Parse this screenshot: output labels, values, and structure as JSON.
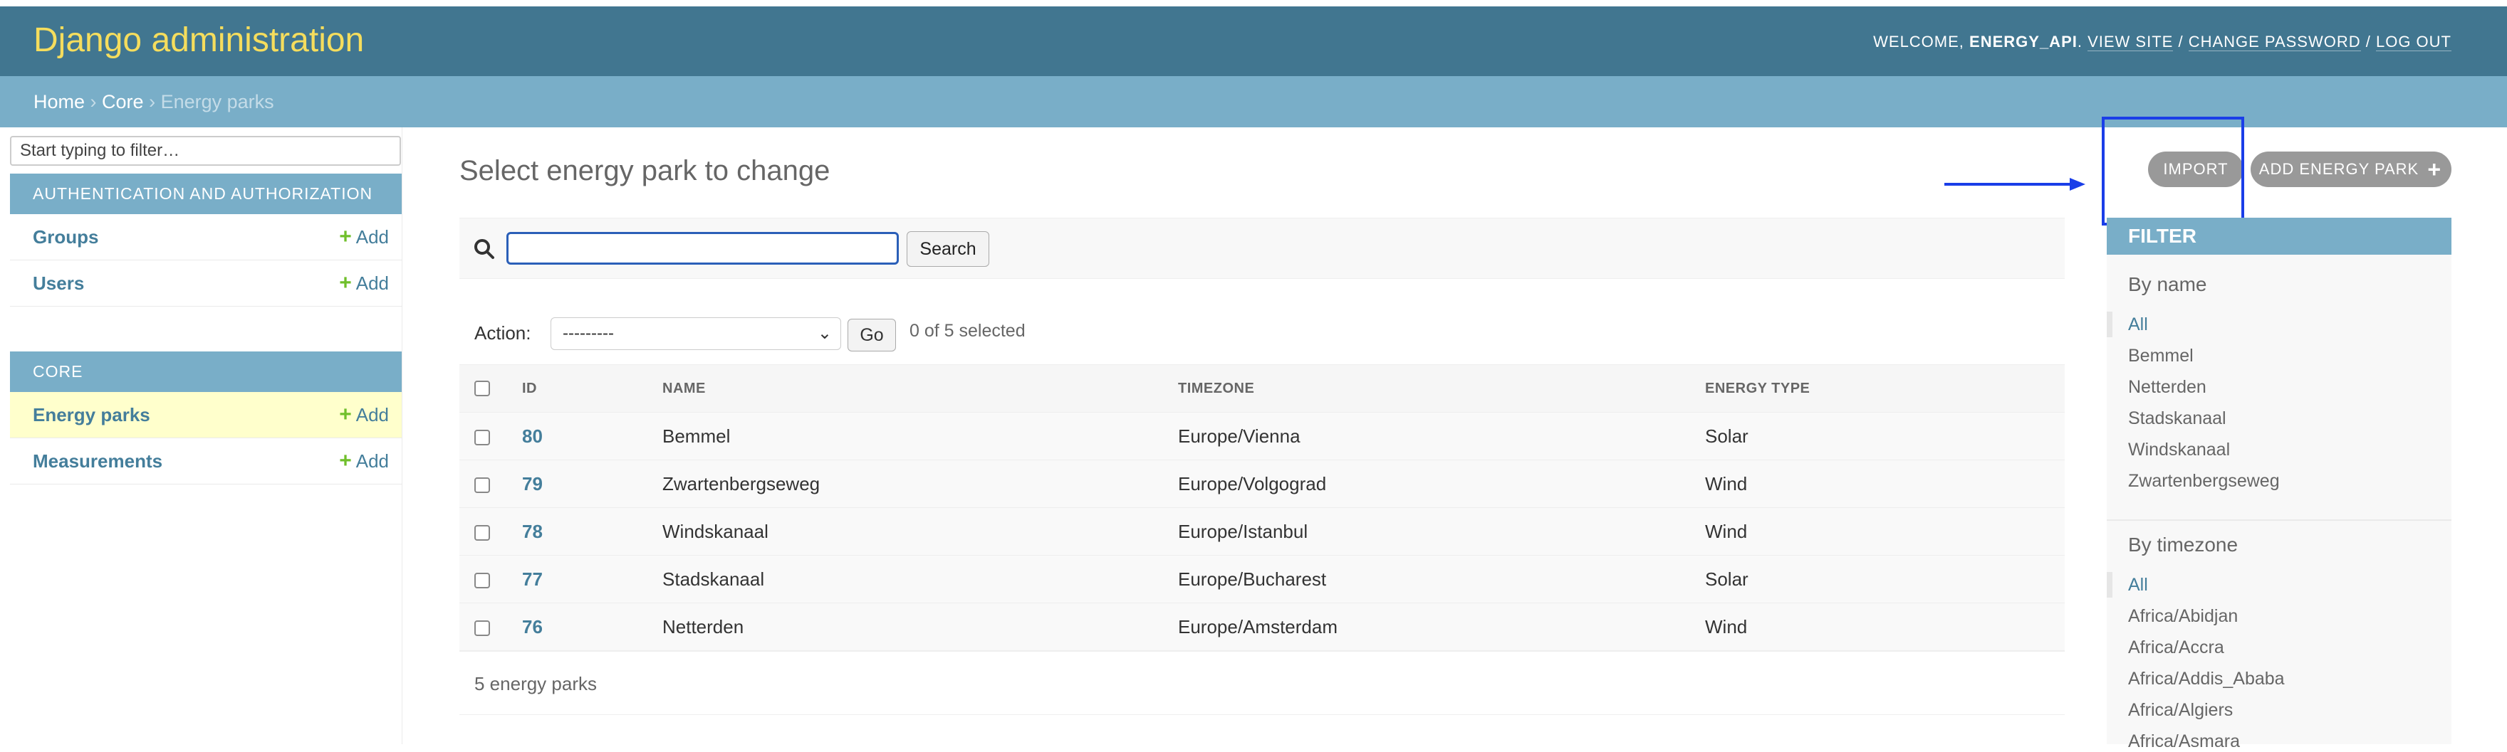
{
  "header": {
    "branding": "Django administration",
    "welcome": "WELCOME, ",
    "user": "ENERGY_API",
    "sep_after_user": ". ",
    "view_site": "VIEW SITE",
    "slash1": " / ",
    "change_password": "CHANGE PASSWORD",
    "slash2": " / ",
    "log_out": "LOG OUT"
  },
  "breadcrumbs": {
    "home": "Home",
    "sep1": " › ",
    "core": "Core",
    "sep2": " › ",
    "current": "Energy parks"
  },
  "sidebar": {
    "filter_placeholder": "Start typing to filter…",
    "auth_caption": "AUTHENTICATION AND AUTHORIZATION",
    "core_caption": "CORE",
    "add_label": "Add",
    "auth_models": [
      "Groups",
      "Users"
    ],
    "core_models": [
      "Energy parks",
      "Measurements"
    ]
  },
  "content": {
    "title": "Select energy park to change",
    "import_label": "IMPORT",
    "add_label": "ADD ENERGY PARK",
    "search_button": "Search",
    "search_value": "",
    "action_label": "Action:",
    "action_selected": "---------",
    "go_label": "Go",
    "selection_counter": "0 of 5 selected",
    "columns": [
      "ID",
      "NAME",
      "TIMEZONE",
      "ENERGY TYPE"
    ],
    "rows": [
      {
        "id": "80",
        "name": "Bemmel",
        "timezone": "Europe/Vienna",
        "energy_type": "Solar"
      },
      {
        "id": "79",
        "name": "Zwartenbergseweg",
        "timezone": "Europe/Volgograd",
        "energy_type": "Wind"
      },
      {
        "id": "78",
        "name": "Windskanaal",
        "timezone": "Europe/Istanbul",
        "energy_type": "Wind"
      },
      {
        "id": "77",
        "name": "Stadskanaal",
        "timezone": "Europe/Bucharest",
        "energy_type": "Solar"
      },
      {
        "id": "76",
        "name": "Netterden",
        "timezone": "Europe/Amsterdam",
        "energy_type": "Wind"
      }
    ],
    "paginator": "5 energy parks"
  },
  "filter": {
    "title": "FILTER",
    "by_name": {
      "heading": "By name",
      "items": [
        "All",
        "Bemmel",
        "Netterden",
        "Stadskanaal",
        "Windskanaal",
        "Zwartenbergseweg"
      ]
    },
    "by_timezone": {
      "heading": "By timezone",
      "items": [
        "All",
        "Africa/Abidjan",
        "Africa/Accra",
        "Africa/Addis_Ababa",
        "Africa/Algiers",
        "Africa/Asmara"
      ]
    }
  },
  "colors": {
    "header": "#417690",
    "branding": "#f5dd5d",
    "breadcrumbs": "#79aec8",
    "link": "#447e9b",
    "add_green": "#70bf2b",
    "annotation": "#1a3ee8"
  }
}
